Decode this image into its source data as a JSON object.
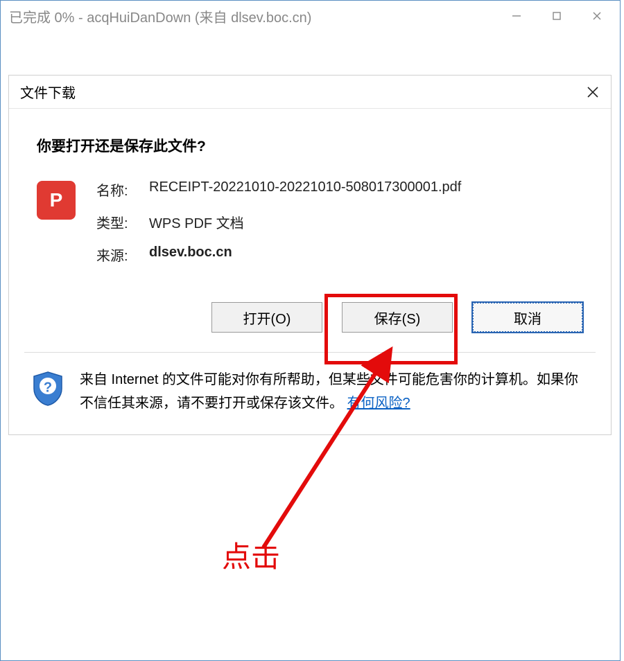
{
  "parent": {
    "title": "已完成 0% - acqHuiDanDown (来自 dlsev.boc.cn)"
  },
  "dialog": {
    "title": "文件下载",
    "question": "你要打开还是保存此文件?",
    "file": {
      "name_label": "名称:",
      "name": "RECEIPT-20221010-20221010-508017300001.pdf",
      "type_label": "类型:",
      "type": "WPS PDF 文档",
      "source_label": "来源:",
      "source": "dlsev.boc.cn"
    },
    "buttons": {
      "open": "打开(O)",
      "save": "保存(S)",
      "cancel": "取消"
    },
    "warning_text_1": "来自 Internet 的文件可能对你有所帮助，但某些文件可能危害你的计算机。如果你不信任其来源，请不要打开或保存该文件。",
    "warning_link": "有何风险?"
  },
  "annotation": {
    "label": "点击"
  },
  "icons": {
    "pdf_letter": "P"
  }
}
